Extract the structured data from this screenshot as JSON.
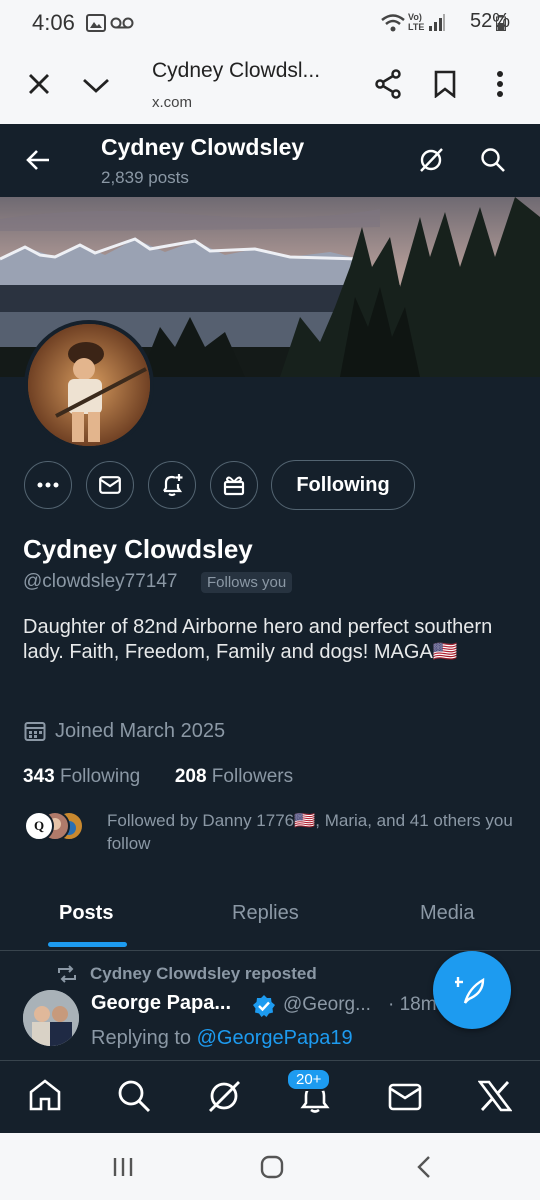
{
  "status_bar": {
    "time": "4:06",
    "battery": "52%"
  },
  "browser": {
    "title": "Cydney Clowdsl...",
    "url": "x.com"
  },
  "header": {
    "name": "Cydney Clowdsley",
    "posts_count": "2,839 posts"
  },
  "profile": {
    "name": "Cydney Clowdsley",
    "handle": "@clowdsley77147",
    "follows_you": "Follows you",
    "bio": "Daughter of 82nd Airborne hero and perfect southern lady. Faith, Freedom, Family and dogs! MAGA🇺🇸",
    "joined": "Joined March 2025",
    "following_count": "343",
    "following_label": "Following",
    "followers_count": "208",
    "followers_label": "Followers",
    "followed_by": "Followed by Danny 1776🇺🇸, Maria, and 41 others you follow",
    "follow_button": "Following"
  },
  "tabs": [
    "Posts",
    "Replies",
    "Media"
  ],
  "post": {
    "repost_label": "Cydney Clowdsley reposted",
    "author": "George Papa...",
    "handle": "@Georg...",
    "time": "· 18m",
    "replying_prefix": "Replying to ",
    "replying_to": "@GeorgePapa19"
  },
  "bottom_nav": {
    "badge": "20+"
  },
  "colors": {
    "background": "#15202b",
    "accent": "#1d9bf0",
    "muted": "#8b98a5"
  },
  "icons": [
    "back-arrow-icon",
    "grok-icon",
    "search-icon",
    "more-icon",
    "mail-icon",
    "notify-icon",
    "gift-icon",
    "calendar-icon",
    "repost-icon",
    "verified-icon",
    "compose-icon",
    "home-icon",
    "bell-icon",
    "x-logo-icon",
    "close-icon",
    "chevron-down-icon",
    "share-icon",
    "bookmark-icon",
    "kebab-icon"
  ]
}
